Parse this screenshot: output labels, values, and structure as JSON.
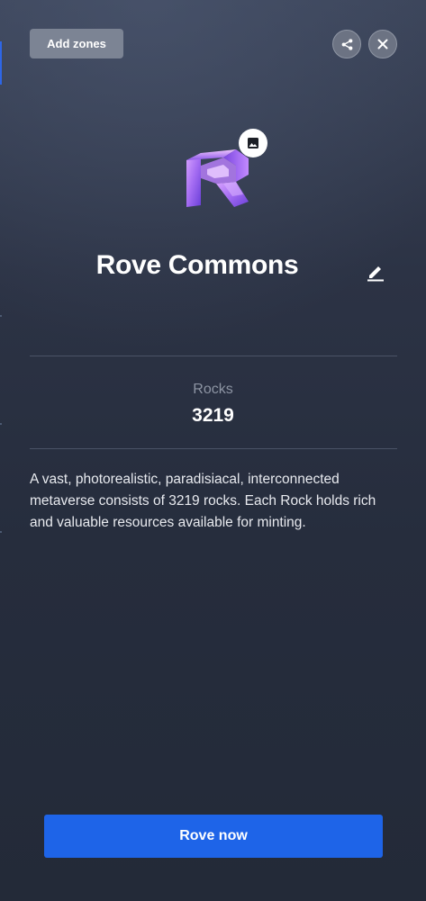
{
  "header": {
    "add_zones_label": "Add zones",
    "share_icon": "share-icon",
    "close_icon": "close-icon"
  },
  "zone": {
    "logo": "rove-logo",
    "image_icon": "image-icon",
    "title": "Rove Commons",
    "edit_icon": "edit-icon"
  },
  "stats": {
    "label": "Rocks",
    "value": "3219"
  },
  "description": "A vast, photorealistic, paradisiacal, interconnected metaverse consists of 3219 rocks. Each Rock holds rich and valuable resources available for minting.",
  "cta": {
    "label": "Rove now"
  },
  "colors": {
    "accent": "#1e64e8",
    "logo_gradient_start": "#c78cff",
    "logo_gradient_end": "#6a3fd8"
  }
}
